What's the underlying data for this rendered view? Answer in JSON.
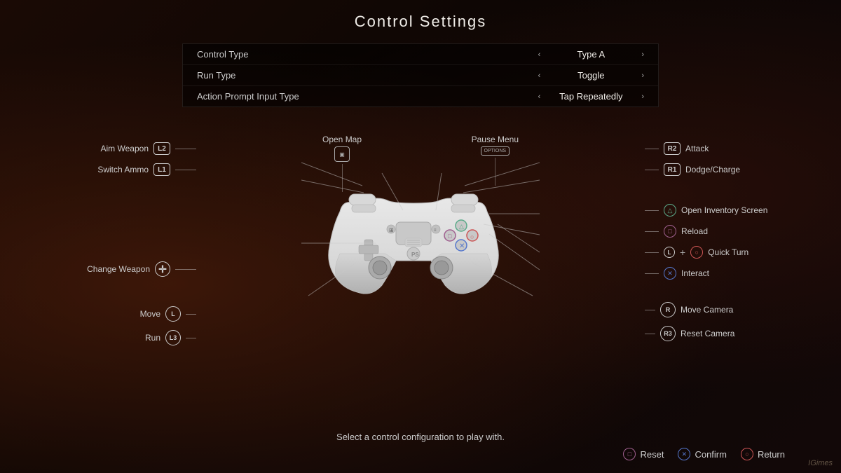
{
  "title": "Control Settings",
  "settings": [
    {
      "label": "Control Type",
      "value": "Type A"
    },
    {
      "label": "Run Type",
      "value": "Toggle"
    },
    {
      "label": "Action Prompt Input Type",
      "value": "Tap Repeatedly"
    }
  ],
  "left_controls": [
    {
      "label": "Aim Weapon",
      "badge": "L2",
      "type": "rect"
    },
    {
      "label": "Switch Ammo",
      "badge": "L1",
      "type": "rect"
    },
    {
      "label": "Change Weapon",
      "badge": "✛",
      "type": "dpad"
    }
  ],
  "top_controls": [
    {
      "label": "Open Map",
      "badge": "🎮"
    },
    {
      "label": "Pause Menu",
      "badge": "OPTIONS"
    }
  ],
  "right_controls": [
    {
      "label": "Attack",
      "badge": "R2",
      "symbol": ""
    },
    {
      "label": "Dodge/Charge",
      "badge": "R1",
      "symbol": ""
    },
    {
      "label": "Open Inventory Screen",
      "symbol": "△"
    },
    {
      "label": "Reload",
      "symbol": "□"
    },
    {
      "label": "Quick Turn",
      "symbol": "○",
      "extra": "L+"
    },
    {
      "label": "Interact",
      "symbol": "✕"
    }
  ],
  "bottom_left_controls": [
    {
      "label": "Move",
      "badge": "L"
    },
    {
      "label": "Run",
      "badge": "L3"
    }
  ],
  "bottom_right_controls": [
    {
      "label": "Move Camera",
      "badge": "R"
    },
    {
      "label": "Reset Camera",
      "badge": "R3"
    }
  ],
  "hint": "Select a control configuration to play with.",
  "footer_buttons": [
    {
      "label": "Reset",
      "symbol": "□"
    },
    {
      "label": "Confirm",
      "symbol": "✕"
    },
    {
      "label": "Return",
      "symbol": "○"
    }
  ],
  "watermark": "IGimes"
}
